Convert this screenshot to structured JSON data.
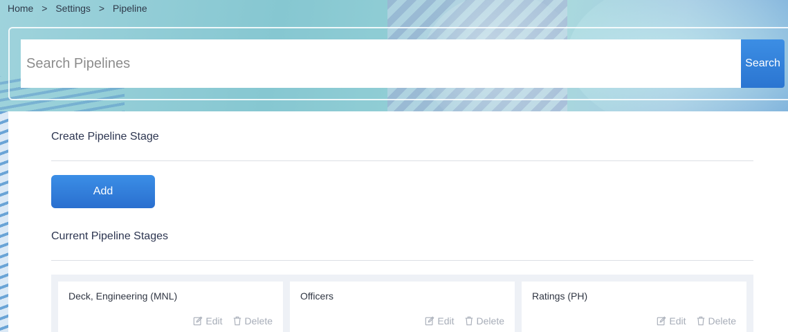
{
  "breadcrumb": {
    "items": [
      "Home",
      "Settings",
      "Pipeline"
    ],
    "separator": ">"
  },
  "search": {
    "placeholder": "Search Pipelines",
    "value": "",
    "button_label": "Search"
  },
  "create_section": {
    "title": "Create Pipeline Stage",
    "add_label": "Add"
  },
  "current_section": {
    "title": "Current Pipeline Stages",
    "stages": [
      {
        "name": "Deck, Engineering (MNL)",
        "edit_label": "Edit",
        "delete_label": "Delete"
      },
      {
        "name": "Officers",
        "edit_label": "Edit",
        "delete_label": "Delete"
      },
      {
        "name": "Ratings (PH)",
        "edit_label": "Edit",
        "delete_label": "Delete"
      }
    ]
  },
  "colors": {
    "accent": "#2f7ddb",
    "muted_action": "#a7adb8"
  },
  "icons": {
    "edit": "edit-icon",
    "delete": "trash-icon"
  }
}
